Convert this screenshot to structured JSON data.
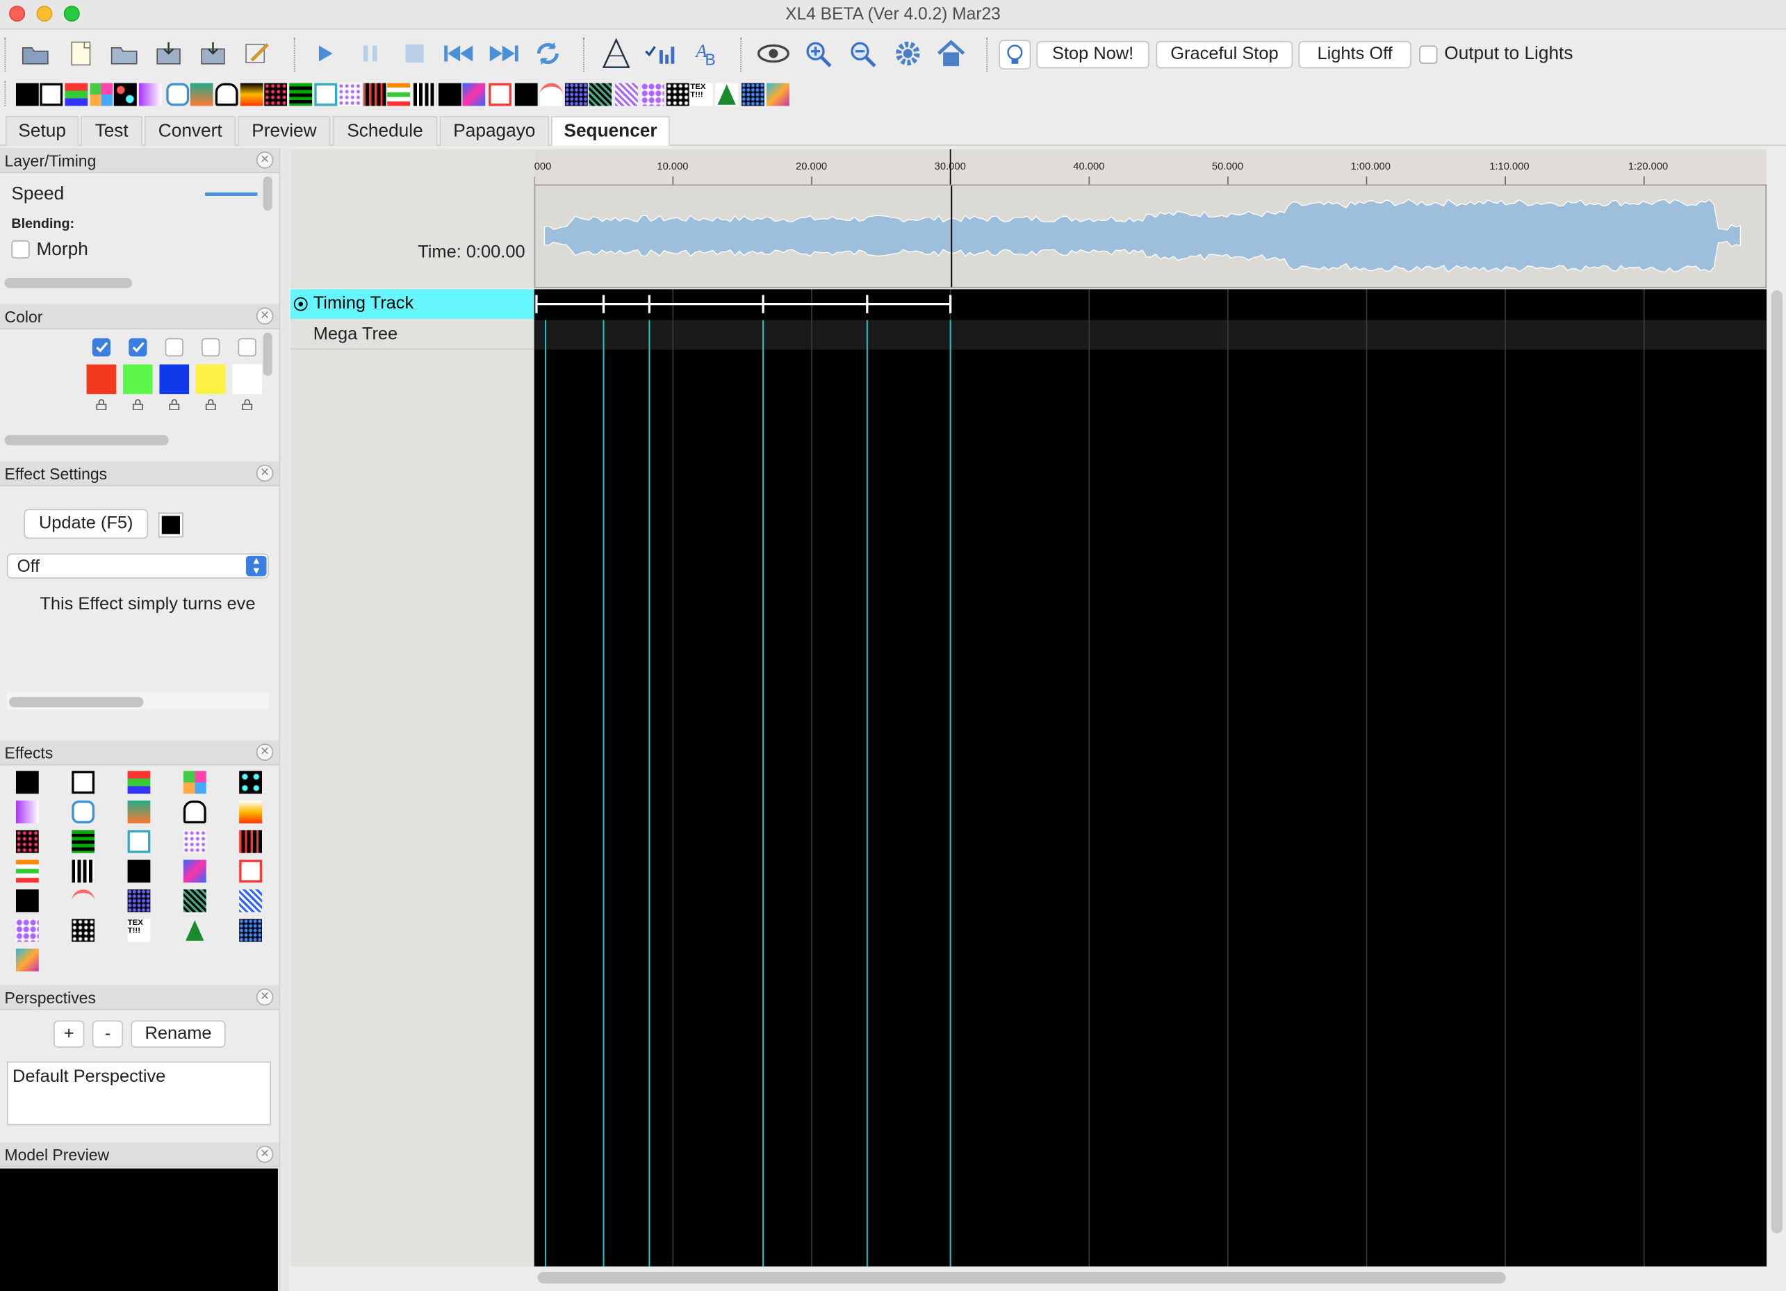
{
  "window": {
    "title": "XL4 BETA (Ver 4.0.2) Mar23"
  },
  "toolbar": {
    "stop_now": "Stop Now!",
    "graceful_stop": "Graceful Stop",
    "lights_off": "Lights Off",
    "output_to_lights": "Output to Lights"
  },
  "tabs": [
    "Setup",
    "Test",
    "Convert",
    "Preview",
    "Schedule",
    "Papagayo",
    "Sequencer"
  ],
  "active_tab": "Sequencer",
  "layer_timing": {
    "title": "Layer/Timing",
    "speed_label": "Speed",
    "blending_label": "Blending:",
    "morph_label": "Morph"
  },
  "color_panel": {
    "title": "Color",
    "palette": [
      {
        "color": "#f23a1f",
        "checked": true
      },
      {
        "color": "#5df74a",
        "checked": true
      },
      {
        "color": "#0f39ea",
        "checked": false
      },
      {
        "color": "#fdf145",
        "checked": false
      },
      {
        "color": "#ffffff",
        "checked": false
      }
    ]
  },
  "effect_settings": {
    "title": "Effect Settings",
    "update_label": "Update (F5)",
    "effect_select": "Off",
    "description": "This Effect simply turns eve"
  },
  "effects_panel": {
    "title": "Effects"
  },
  "perspectives": {
    "title": "Perspectives",
    "add_label": "+",
    "remove_label": "-",
    "rename_label": "Rename",
    "items": [
      "Default Perspective"
    ]
  },
  "model_preview": {
    "title": "Model Preview"
  },
  "sequencer": {
    "time_label": "Time: 0:00.00",
    "ruler_ticks": [
      "000",
      "10.000",
      "20.000",
      "30.000",
      "40.000",
      "50.000",
      "1:00.000",
      "1:10.000",
      "1:20.000"
    ],
    "rows": [
      {
        "label": "Timing Track",
        "type": "timing",
        "selected": true
      },
      {
        "label": "Mega Tree",
        "type": "model",
        "selected": false
      }
    ],
    "timing_marks_seconds": [
      0.0,
      5.0,
      8.3,
      16.5,
      24.0,
      30.0
    ],
    "cursor_seconds": 30.0
  },
  "colors": {
    "timing_row_bg": "#66f6fe",
    "timing_mark": "#1fc8cf",
    "waveform": "#9ebfdc",
    "grid_bg": "#000000",
    "row_header_bg": "#e3e1de"
  }
}
